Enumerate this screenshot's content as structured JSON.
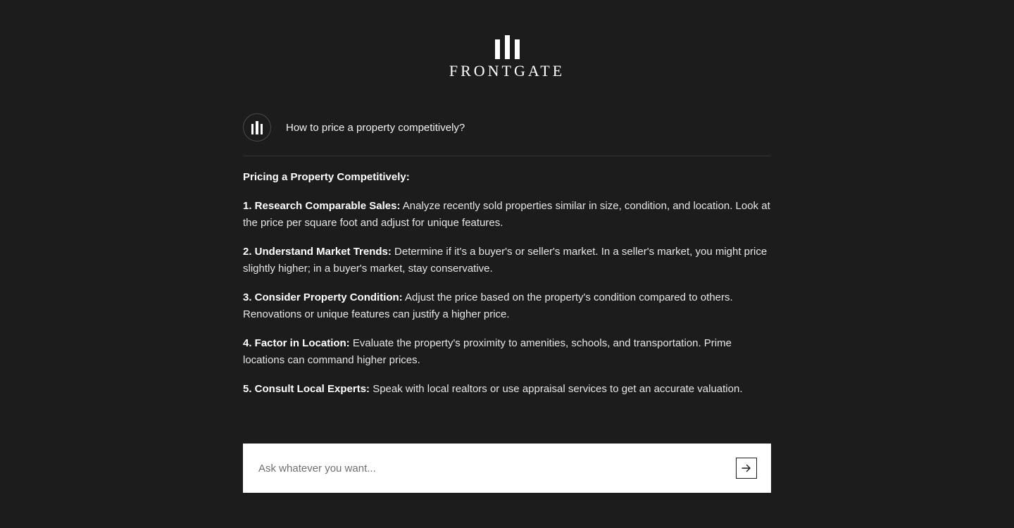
{
  "brand": {
    "name": "FRONTGATE"
  },
  "question": {
    "text": "How to price a property competitively?"
  },
  "answer": {
    "title": "Pricing a Property Competitively:",
    "items": [
      {
        "label": "1. Research Comparable Sales:",
        "text": " Analyze recently sold properties similar in size, condition, and location. Look at the price per square foot and adjust for unique features."
      },
      {
        "label": "2. Understand Market Trends:",
        "text": " Determine if it's a buyer's or seller's market. In a seller's market, you might price slightly higher; in a buyer's market, stay conservative."
      },
      {
        "label": "3. Consider Property Condition:",
        "text": " Adjust the price based on the property's condition compared to others. Renovations or unique features can justify a higher price."
      },
      {
        "label": "4. Factor in Location:",
        "text": " Evaluate the property's proximity to amenities, schools, and transportation. Prime locations can command higher prices."
      },
      {
        "label": "5. Consult Local Experts:",
        "text": " Speak with local realtors or use appraisal services to get an accurate valuation."
      }
    ]
  },
  "input": {
    "placeholder": "Ask whatever you want...",
    "value": ""
  },
  "icons": {
    "logo": "three-bars-logo-icon",
    "avatar": "three-bars-avatar-icon",
    "send": "arrow-right-icon"
  },
  "colors": {
    "background": "#1c1c1c",
    "text": "#ececec",
    "input_background": "#ffffff"
  }
}
